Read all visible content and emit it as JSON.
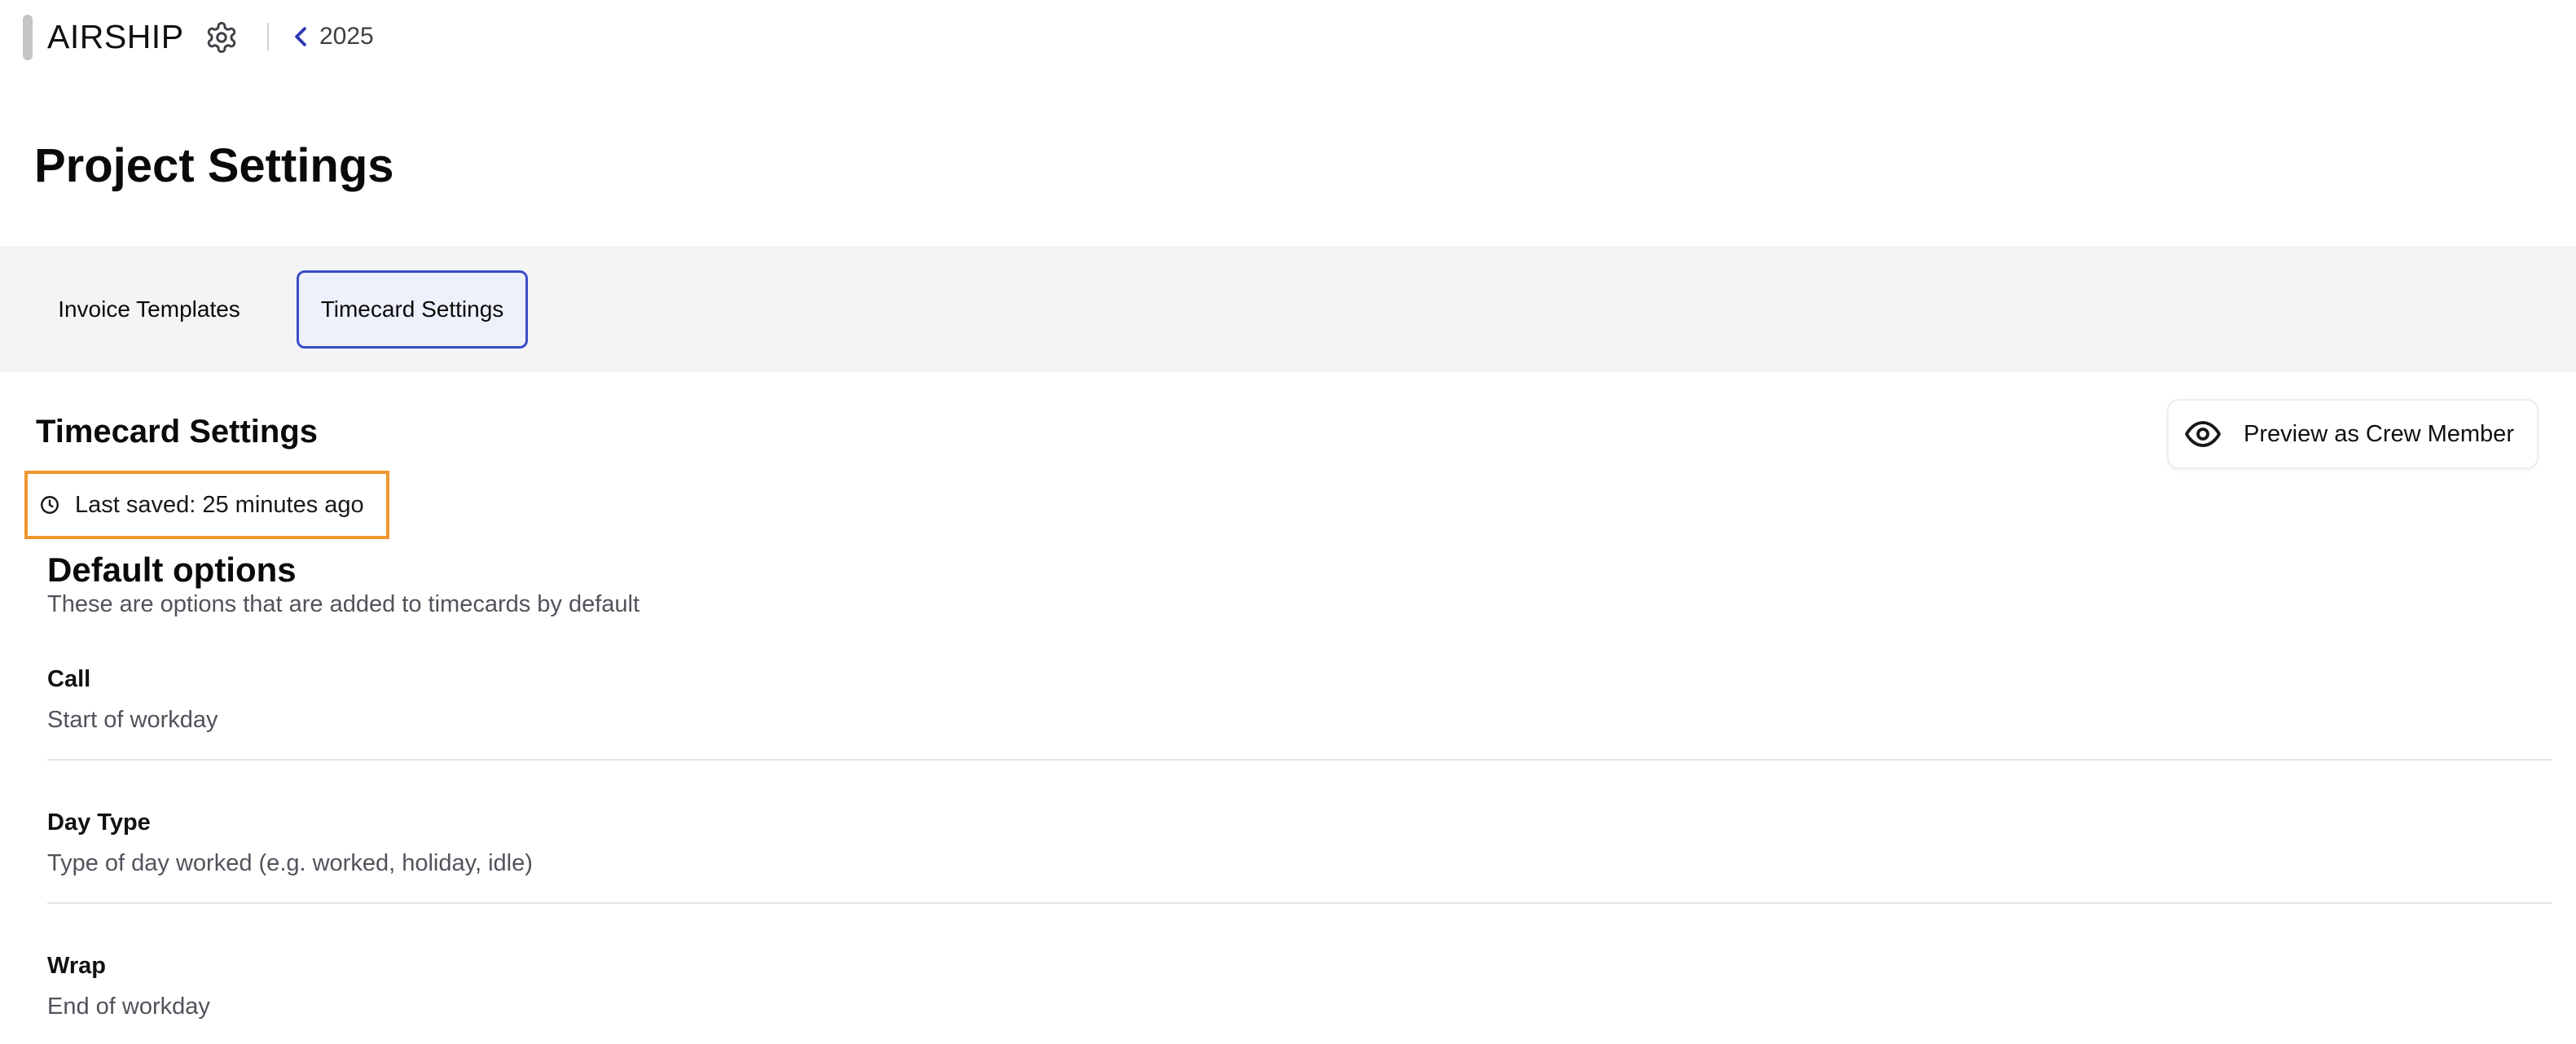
{
  "header": {
    "brand": "AIRSHIP",
    "back_label": "2025",
    "icons": {
      "settings": "gear-icon",
      "back": "chevron-left-icon"
    }
  },
  "page": {
    "title": "Project Settings"
  },
  "tabs": [
    {
      "label": "Invoice Templates",
      "active": false
    },
    {
      "label": "Timecard Settings",
      "active": true
    }
  ],
  "section": {
    "title": "Timecard Settings",
    "last_saved": "Last saved: 25 minutes ago",
    "preview_button": "Preview as Crew Member"
  },
  "default_options": {
    "title": "Default options",
    "subtitle": "These are options that are added to timecards by default",
    "items": [
      {
        "name": "Call",
        "description": "Start of workday"
      },
      {
        "name": "Day Type",
        "description": "Type of day worked (e.g. worked, holiday, idle)"
      },
      {
        "name": "Wrap",
        "description": "End of workday"
      }
    ]
  },
  "colors": {
    "accent": "#3b4cca",
    "active_tab_bg": "#eef0fb",
    "highlight_border": "#f0962e",
    "tab_band_bg": "#f4f4f5",
    "muted_text": "#52525b"
  }
}
